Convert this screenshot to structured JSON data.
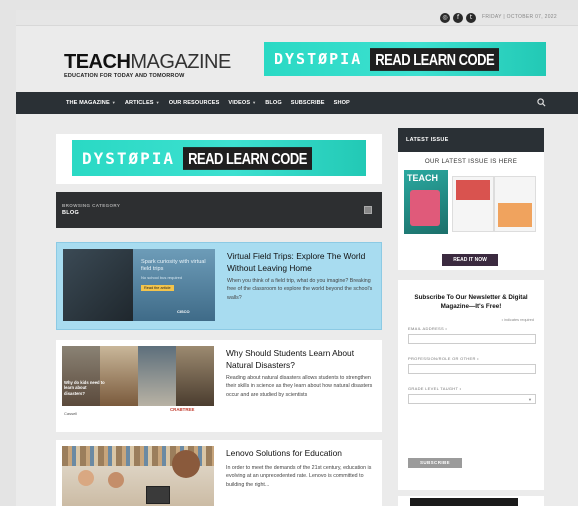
{
  "topbar": {
    "social_icons": [
      "instagram-icon",
      "facebook-icon",
      "twitter-icon"
    ],
    "date": "FRIDAY | OCTOBER 07, 2022"
  },
  "header": {
    "logo_bold": "TEACH",
    "logo_thin": "MAGAZINE",
    "logo_tagline": "EDUCATION FOR TODAY AND TOMORROW",
    "banner_dystopia": "DYSTØPIA",
    "banner_cta": "READ LEARN CODE"
  },
  "nav": {
    "items": [
      {
        "label": "THE MAGAZINE",
        "dropdown": true
      },
      {
        "label": "ARTICLES",
        "dropdown": true
      },
      {
        "label": "OUR RESOURCES",
        "dropdown": false
      },
      {
        "label": "VIDEOS",
        "dropdown": true
      },
      {
        "label": "BLOG",
        "dropdown": false
      },
      {
        "label": "SUBSCRIBE",
        "dropdown": false
      },
      {
        "label": "SHOP",
        "dropdown": false
      }
    ],
    "search_icon": "search-icon"
  },
  "main": {
    "banner_dystopia": "DYSTØPIA",
    "banner_cta": "READ LEARN CODE",
    "browsing_label": "BROWSING CATEGORY",
    "category": "BLOG",
    "posts": [
      {
        "title": "Virtual Field Trips: Explore The World Without Leaving Home",
        "excerpt": "When you think of a field trip, what do you imagine? Breaking free of the classroom to explore the world beyond the school's walls?",
        "thumb_text": "Spark curiosity with virtual field trips",
        "thumb_sub": "No school bus required",
        "thumb_btn": "Read the article",
        "thumb_brand": "CISCO"
      },
      {
        "title": "Why Should Students Learn About Natural Disasters?",
        "excerpt": "Reading about natural disasters allows students to strengthen their skills in science as they learn about how natural disasters occur and are studied by scientists",
        "thumb_text": "Why do kids need to learn about disasters?",
        "thumb_brand_left": "Cassell",
        "thumb_brand_right": "CRABTREE"
      },
      {
        "title": "Lenovo Solutions for Education",
        "excerpt": "In order to meet the demands of the 21st century, education is evolving at an unprecedented rate. Lenovo is committed to building the right..."
      }
    ]
  },
  "sidebar": {
    "latest_issue_header": "LATEST ISSUE",
    "latest_issue_caption": "OUR LATEST ISSUE IS HERE",
    "cover_title": "TEACH",
    "read_button": "READ IT NOW",
    "newsletter_title": "Subscribe To Our Newsletter & Digital Magazine—It's Free!",
    "required_note": "• indicates required",
    "field_email": "EMAIL ADDRESS •",
    "field_profession": "PROFESSION/ROLE OR OTHER •",
    "field_grade": "GRADE LEVEL TAUGHT •",
    "subscribe_button": "SUBSCRIBE"
  },
  "colors": {
    "nav_bg": "#2a3035",
    "banner_teal": "#2ad9c4",
    "highlight_post": "#a8dcf0"
  }
}
